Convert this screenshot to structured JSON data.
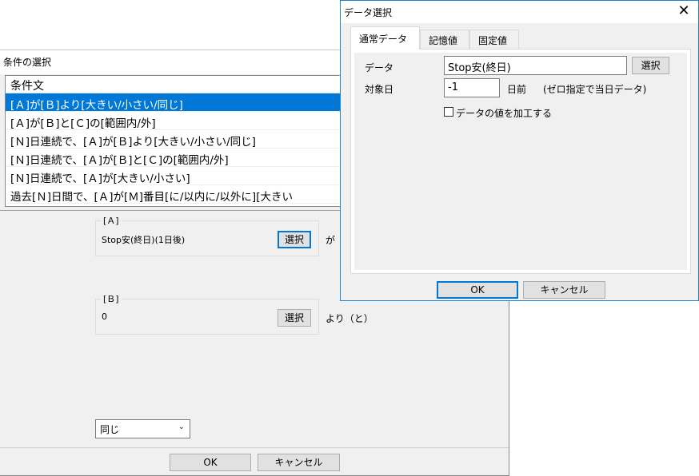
{
  "back_window": {
    "title": "条件の選択",
    "list": {
      "header": "条件文",
      "rows": [
        "[Ａ]が[Ｂ]より[大きい/小さい/同じ]",
        "[Ａ]が[Ｂ]と[Ｃ]の[範囲内/外]",
        "[Ｎ]日連続で、[Ａ]が[Ｂ]より[大きい/小さい/同じ]",
        "[Ｎ]日連続で、[Ａ]が[Ｂ]と[Ｃ]の[範囲内/外]",
        "[Ｎ]日連続で、[Ａ]が[大きい/小さい]",
        "過去[Ｎ]日間で、[Ａ]が[Ｍ]番目[に/以内に/以外に][大きい"
      ]
    },
    "group_a": {
      "label": "[Ａ]",
      "value": "Stop安(終日)(1日後)",
      "select_label": "選択",
      "suffix": "が"
    },
    "group_b": {
      "label": "[Ｂ]",
      "value": "0",
      "select_label": "選択",
      "suffix": "より（と）"
    },
    "compare_select": {
      "value": "同じ"
    },
    "ok_label": "OK",
    "cancel_label": "キャンセル"
  },
  "front_dialog": {
    "title": "データ選択",
    "close_icon": "close-icon",
    "tabs": [
      "通常データ",
      "記憶値",
      "固定値"
    ],
    "active_tab": "通常データ",
    "data_label": "データ",
    "data_value": "Stop安(終日)",
    "select_label": "選択",
    "target_day_label": "対象日",
    "target_day_value": "-1",
    "days_before_label": "日前",
    "hint": "(ゼロ指定で当日データ)",
    "process_checkbox_label": "データの値を加工する",
    "process_checked": false,
    "ok_label": "OK",
    "cancel_label": "キャンセル"
  },
  "colors": {
    "selection": "#0078d7",
    "dialog_bg": "#f0f0f0",
    "focus_border": "#0078d7"
  }
}
